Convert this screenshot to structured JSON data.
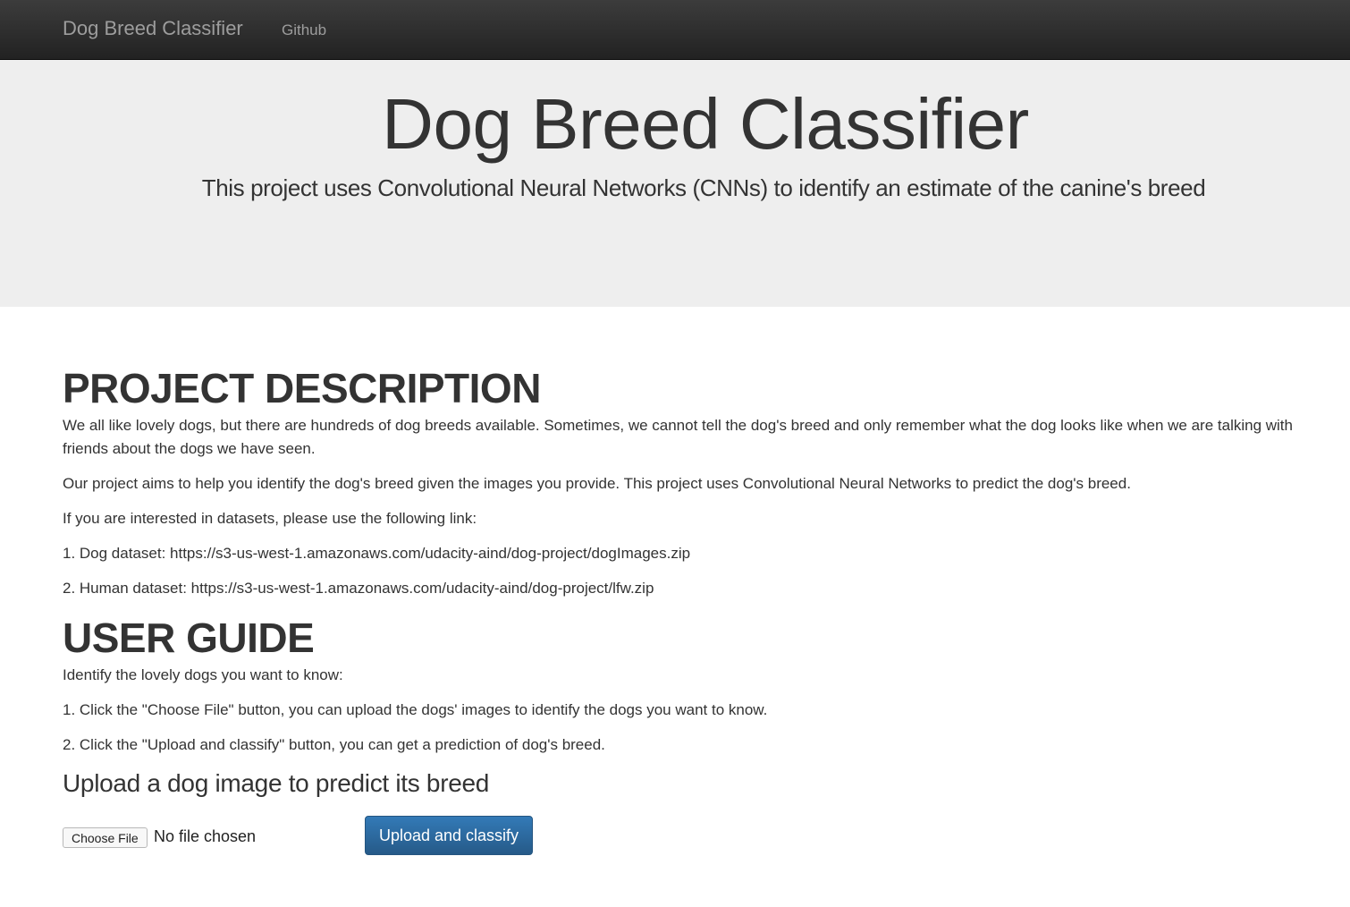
{
  "navbar": {
    "brand": "Dog Breed Classifier",
    "links": [
      "Github"
    ]
  },
  "jumbotron": {
    "title": "Dog Breed Classifier",
    "subtitle": "This project uses Convolutional Neural Networks (CNNs) to identify an estimate of the canine's breed"
  },
  "description": {
    "heading": "PROJECT DESCRIPTION",
    "paragraphs": [
      "We all like lovely dogs, but there are hundreds of dog breeds available. Sometimes, we cannot tell the dog's breed and only remember what the dog looks like when we are talking with friends about the dogs we have seen.",
      "Our project aims to help you identify the dog's breed given the images you provide. This project uses Convolutional Neural Networks to predict the dog's breed.",
      "If you are interested in datasets, please use the following link:",
      "1. Dog dataset: https://s3-us-west-1.amazonaws.com/udacity-aind/dog-project/dogImages.zip",
      "2. Human dataset: https://s3-us-west-1.amazonaws.com/udacity-aind/dog-project/lfw.zip"
    ]
  },
  "guide": {
    "heading": "USER GUIDE",
    "paragraphs": [
      "Identify the lovely dogs you want to know:",
      "1. Click the \"Choose File\" button, you can upload the dogs' images to identify the dogs you want to know.",
      "2. Click the \"Upload and classify\" button, you can get a prediction of dog's breed."
    ]
  },
  "upload": {
    "title": "Upload a dog image to predict its breed",
    "choose_label": "Choose File",
    "file_status": "No file chosen",
    "submit_label": "Upload and classify"
  },
  "colors": {
    "navbar": "#222222",
    "jumbotron": "#eeeeee",
    "primary_button": "#337ab7"
  }
}
